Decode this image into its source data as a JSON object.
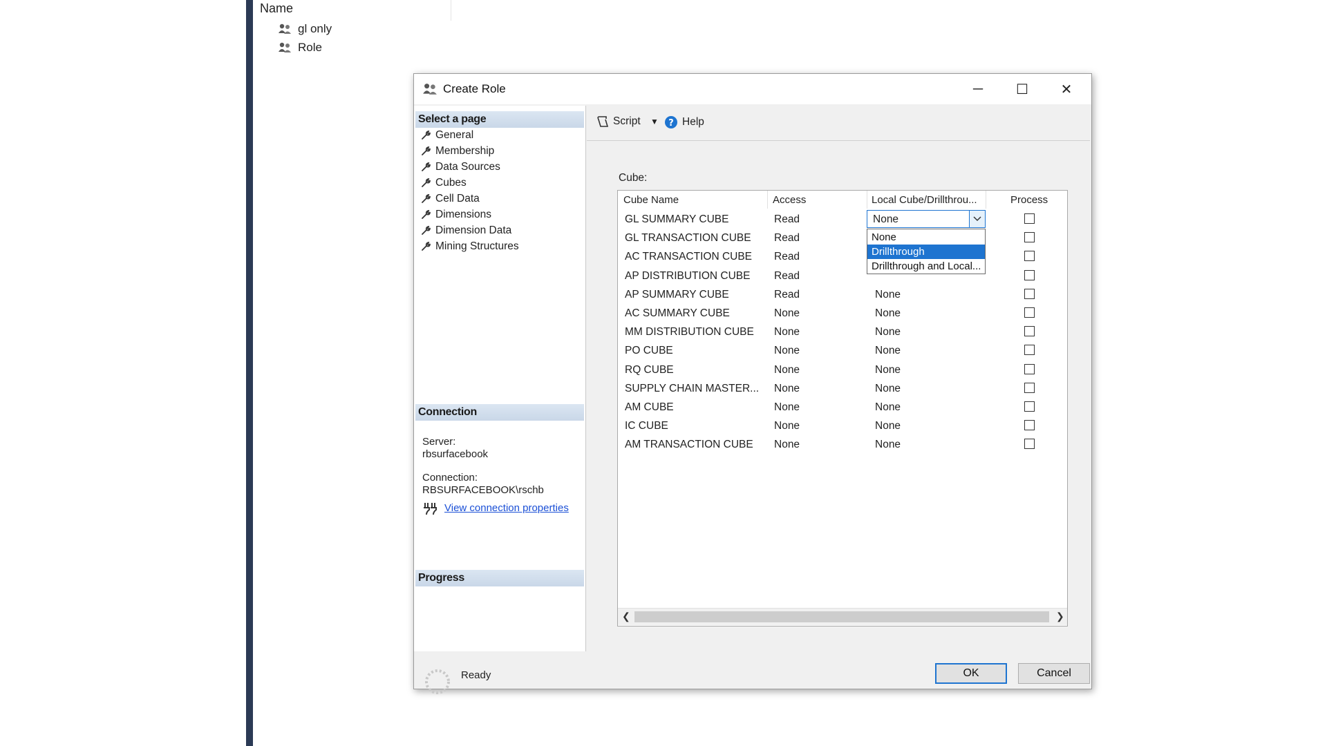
{
  "background": {
    "column_header": "Name",
    "items": [
      {
        "label": "gl only",
        "icon": "role-icon"
      },
      {
        "label": "Role",
        "icon": "role-icon"
      }
    ]
  },
  "dialog": {
    "title": "Create Role",
    "title_icon": "role-icon",
    "window_controls": {
      "minimize": "─",
      "maximize": "☐",
      "close": "✕"
    },
    "select_page": {
      "header": "Select a page",
      "items": [
        "General",
        "Membership",
        "Data Sources",
        "Cubes",
        "Cell Data",
        "Dimensions",
        "Dimension Data",
        "Mining Structures"
      ],
      "selected": "Cubes"
    },
    "connection": {
      "header": "Connection",
      "server_label": "Server:",
      "server_value": "rbsurfacebook",
      "connection_label": "Connection:",
      "connection_value": "RBSURFACEBOOK\\rschb",
      "link": "View connection properties"
    },
    "progress": {
      "header": "Progress",
      "status": "Ready"
    },
    "toolbar": {
      "script_label": "Script",
      "help_label": "Help"
    },
    "cube_label": "Cube:",
    "grid": {
      "columns": [
        "Cube Name",
        "Access",
        "Local Cube/Drillthrou...",
        "Process"
      ],
      "rows": [
        {
          "name": "GL SUMMARY CUBE",
          "access": "Read",
          "local": "None",
          "process": false
        },
        {
          "name": "GL TRANSACTION CUBE",
          "access": "Read",
          "local": "",
          "process": false
        },
        {
          "name": "AC TRANSACTION CUBE",
          "access": "Read",
          "local": "",
          "process": false
        },
        {
          "name": "AP DISTRIBUTION CUBE",
          "access": "Read",
          "local": "",
          "process": false
        },
        {
          "name": "AP SUMMARY CUBE",
          "access": "Read",
          "local": "None",
          "process": false
        },
        {
          "name": "AC SUMMARY CUBE",
          "access": "None",
          "local": "None",
          "process": false
        },
        {
          "name": "MM DISTRIBUTION CUBE",
          "access": "None",
          "local": "None",
          "process": false
        },
        {
          "name": "PO CUBE",
          "access": "None",
          "local": "None",
          "process": false
        },
        {
          "name": "RQ CUBE",
          "access": "None",
          "local": "None",
          "process": false
        },
        {
          "name": "SUPPLY CHAIN MASTER...",
          "access": "None",
          "local": "None",
          "process": false
        },
        {
          "name": "AM CUBE",
          "access": "None",
          "local": "None",
          "process": false
        },
        {
          "name": "IC CUBE",
          "access": "None",
          "local": "None",
          "process": false
        },
        {
          "name": "AM TRANSACTION CUBE",
          "access": "None",
          "local": "None",
          "process": false
        }
      ],
      "combo_value": "None",
      "dropdown_options": [
        "None",
        "Drillthrough",
        "Drillthrough and Local..."
      ],
      "dropdown_selected": "Drillthrough"
    },
    "buttons": {
      "ok": "OK",
      "cancel": "Cancel"
    },
    "colors": {
      "accent": "#1e74d0",
      "section_header": "#c9d7e8",
      "link": "#1a4fd6"
    }
  }
}
